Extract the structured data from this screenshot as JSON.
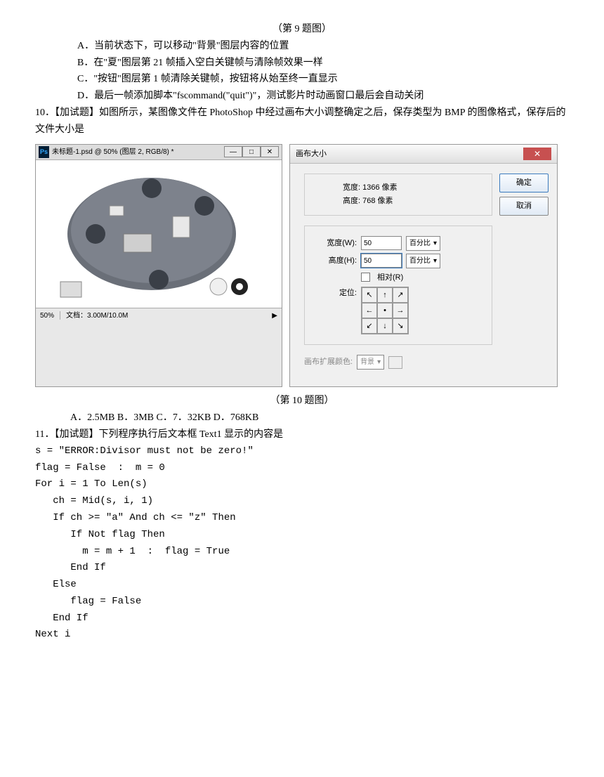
{
  "q9": {
    "caption": "（第 9 题图）",
    "options": {
      "A": "A．当前状态下，可以移动\"背景\"图层内容的位置",
      "B": "B．在\"夏\"图层第 21 帧插入空白关键帧与清除帧效果一样",
      "C": "C．\"按钮\"图层第 1 帧清除关键帧，按钮将从始至终一直显示",
      "D": "D．最后一帧添加脚本\"fscommand(\"quit\")\"，测试影片时动画窗口最后会自动关闭"
    }
  },
  "q10": {
    "stem": "10．【加试题】如图所示，某图像文件在 PhotoShop 中经过画布大小调整确定之后，保存类型为 BMP 的图像格式，保存后的文件大小是",
    "caption": "（第 10 题图）",
    "options": "A．2.5MB      B．3MB      C．7．32KB      D．768KB",
    "ps": {
      "icon": "Ps",
      "title": "未标题-1.psd @ 50% (图层 2, RGB/8) *",
      "status_zoom": "50%",
      "status_doc": "文档：3.00M/10.0M",
      "image_alt": "meeting-table-illustration"
    },
    "dialog": {
      "title": "画布大小",
      "info_w": "宽度: 1366 像素",
      "info_h": "高度: 768 像素",
      "width_label": "宽度(W):",
      "width_value": "50",
      "width_unit": "百分比",
      "height_label": "高度(H):",
      "height_value": "50",
      "height_unit": "百分比",
      "relative": "相对(R)",
      "anchor_label": "定位:",
      "ext_label": "画布扩展颜色:",
      "ext_value": "背景",
      "ok": "确定",
      "cancel": "取消"
    }
  },
  "q11": {
    "stem": "11．【加试题】下列程序执行后文本框 Text1 显示的内容是",
    "code": "s = \"ERROR:Divisor must not be zero!\"\nflag = False  :  m = 0\nFor i = 1 To Len(s)\n   ch = Mid(s, i, 1)\n   If ch >= \"a\" And ch <= \"z\" Then\n      If Not flag Then\n        m = m + 1  :  flag = True\n      End If\n   Else\n      flag = False\n   End If\nNext i"
  }
}
